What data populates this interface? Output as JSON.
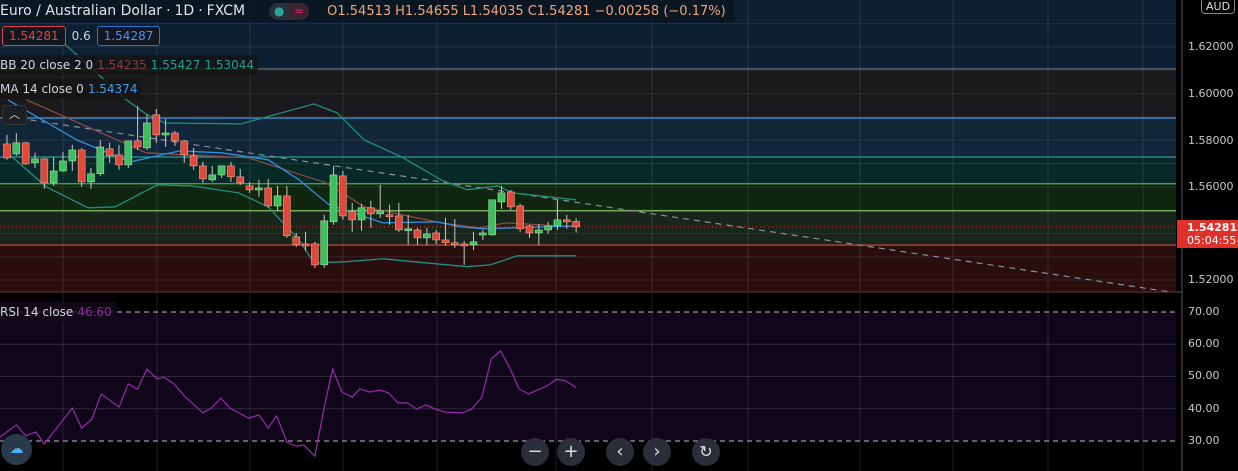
{
  "header": {
    "symbol": "Euro / Australian Dollar",
    "interval": "1D",
    "exchange": "FXCM",
    "separator": "·",
    "toggle_icon": "wave-icon",
    "ohlc": {
      "open": "O1.54513",
      "high": "H1.54655",
      "low": "L1.54035",
      "close": "C1.54281",
      "change": "−0.00258 (−0.17%)"
    }
  },
  "trade": {
    "sell_price": "1.54281",
    "spread": "0.6",
    "buy_price": "1.54287"
  },
  "indicators": {
    "bb": {
      "label": "BB 20 close 2 0",
      "basis": "1.54235",
      "upper": "1.55427",
      "lower": "1.53044"
    },
    "ma": {
      "label": "MA 14 close 0",
      "value": "1.54374"
    },
    "rsi": {
      "label": "RSI 14 close",
      "value": "46.60"
    }
  },
  "price_axis": {
    "currency": "AUD",
    "ticks": [
      "1.62000",
      "1.60000",
      "1.58000",
      "1.56000",
      "1.52000"
    ],
    "current_price": "1.54281",
    "countdown": "05:04:55"
  },
  "rsi_axis": {
    "ticks": [
      "70.00",
      "60.00",
      "50.00",
      "40.00",
      "30.00"
    ]
  },
  "controls": {
    "zoom_out": "−",
    "zoom_in": "+",
    "scroll_left": "‹",
    "scroll_right": "›",
    "reset": "↻"
  },
  "colors": {
    "up": "#3fbf5f",
    "down": "#e0483a",
    "bb_band": "#1f8f80",
    "bb_basis": "#8a4a44",
    "ma": "#2f8fdf",
    "rsi": "#9c27b0",
    "current": "#e0302a"
  },
  "chart_data": {
    "type": "candlestick",
    "price_range": [
      1.515,
      1.63
    ],
    "rsi_range": [
      22,
      78
    ],
    "candles": [
      [
        1.5784,
        1.5823,
        1.5716,
        1.5724
      ],
      [
        1.5741,
        1.5831,
        1.5733,
        1.5789
      ],
      [
        1.5789,
        1.5793,
        1.5694,
        1.5698
      ],
      [
        1.5703,
        1.5746,
        1.5681,
        1.572
      ],
      [
        1.572,
        1.5724,
        1.5591,
        1.5617
      ],
      [
        1.5617,
        1.5728,
        1.5604,
        1.5668
      ],
      [
        1.5668,
        1.575,
        1.5664,
        1.5711
      ],
      [
        1.5711,
        1.578,
        1.5668,
        1.5758
      ],
      [
        1.5758,
        1.5767,
        1.56,
        1.5621
      ],
      [
        1.5621,
        1.5681,
        1.5591,
        1.5656
      ],
      [
        1.5656,
        1.5801,
        1.5647,
        1.5771
      ],
      [
        1.5763,
        1.5789,
        1.5703,
        1.5733
      ],
      [
        1.5737,
        1.578,
        1.5673,
        1.5694
      ],
      [
        1.5694,
        1.5797,
        1.5681,
        1.5797
      ],
      [
        1.5797,
        1.5947,
        1.5758,
        1.5771
      ],
      [
        1.5767,
        1.5909,
        1.5758,
        1.5874
      ],
      [
        1.5909,
        1.5934,
        1.5789,
        1.5823
      ],
      [
        1.5823,
        1.5891,
        1.5771,
        1.5831
      ],
      [
        1.5831,
        1.584,
        1.5776,
        1.5797
      ],
      [
        1.5797,
        1.5801,
        1.5703,
        1.5737
      ],
      [
        1.5733,
        1.5767,
        1.5673,
        1.569
      ],
      [
        1.569,
        1.5707,
        1.5617,
        1.5634
      ],
      [
        1.563,
        1.569,
        1.5621,
        1.5651
      ],
      [
        1.5651,
        1.569,
        1.5638,
        1.569
      ],
      [
        1.569,
        1.5707,
        1.5621,
        1.5643
      ],
      [
        1.5643,
        1.5677,
        1.5608,
        1.5617
      ],
      [
        1.5604,
        1.5621,
        1.5574,
        1.5587
      ],
      [
        1.5587,
        1.563,
        1.5557,
        1.5595
      ],
      [
        1.5595,
        1.5634,
        1.551,
        1.5518
      ],
      [
        1.5518,
        1.5604,
        1.5497,
        1.5561
      ],
      [
        1.5561,
        1.5604,
        1.5381,
        1.539
      ],
      [
        1.5385,
        1.5402,
        1.5342,
        1.5351
      ],
      [
        1.5355,
        1.5407,
        1.5325,
        1.5351
      ],
      [
        1.5355,
        1.5364,
        1.5252,
        1.5265
      ],
      [
        1.5265,
        1.548,
        1.5252,
        1.5454
      ],
      [
        1.545,
        1.569,
        1.5437,
        1.5651
      ],
      [
        1.5647,
        1.5668,
        1.5458,
        1.5475
      ],
      [
        1.5493,
        1.5531,
        1.5407,
        1.5458
      ],
      [
        1.5458,
        1.5527,
        1.5411,
        1.551
      ],
      [
        1.551,
        1.554,
        1.5424,
        1.5484
      ],
      [
        1.5484,
        1.5608,
        1.5467,
        1.5497
      ],
      [
        1.548,
        1.5523,
        1.5437,
        1.5475
      ],
      [
        1.5475,
        1.5531,
        1.5407,
        1.5415
      ],
      [
        1.5415,
        1.548,
        1.5351,
        1.542
      ],
      [
        1.5415,
        1.5424,
        1.5351,
        1.5381
      ],
      [
        1.5381,
        1.5424,
        1.5351,
        1.5398
      ],
      [
        1.5402,
        1.5415,
        1.5355,
        1.5372
      ],
      [
        1.5372,
        1.5467,
        1.5347,
        1.536
      ],
      [
        1.536,
        1.5462,
        1.5338,
        1.5351
      ],
      [
        1.5355,
        1.5368,
        1.5265,
        1.5351
      ],
      [
        1.5351,
        1.5407,
        1.5329,
        1.5364
      ],
      [
        1.5398,
        1.5415,
        1.5372,
        1.5402
      ],
      [
        1.5394,
        1.5544,
        1.539,
        1.5544
      ],
      [
        1.5535,
        1.5604,
        1.5505,
        1.5574
      ],
      [
        1.5578,
        1.5587,
        1.5501,
        1.5514
      ],
      [
        1.5518,
        1.5527,
        1.5407,
        1.542
      ],
      [
        1.5432,
        1.5437,
        1.5381,
        1.5402
      ],
      [
        1.5402,
        1.5441,
        1.5351,
        1.5415
      ],
      [
        1.5415,
        1.545,
        1.5398,
        1.5432
      ],
      [
        1.5432,
        1.5544,
        1.5415,
        1.5458
      ],
      [
        1.5458,
        1.548,
        1.542,
        1.5454
      ],
      [
        1.54513,
        1.54655,
        1.54035,
        1.54281
      ]
    ],
    "bb_upper": [
      [
        6.7,
        1.623
      ],
      [
        13.8,
        1.5973
      ],
      [
        15.9,
        1.5913
      ],
      [
        17.9,
        1.5874
      ],
      [
        26.1,
        1.587
      ],
      [
        33.9,
        1.5956
      ],
      [
        36.4,
        1.5917
      ],
      [
        39.3,
        1.5801
      ],
      [
        43.3,
        1.5728
      ],
      [
        47.5,
        1.563
      ],
      [
        50.3,
        1.5587
      ],
      [
        53.6,
        1.5604
      ],
      [
        55.2,
        1.5574
      ],
      [
        62,
        1.5544
      ]
    ],
    "bb_basis": [
      [
        3.1,
        1.5973
      ],
      [
        15.9,
        1.5746
      ],
      [
        26.9,
        1.5724
      ],
      [
        35.2,
        1.5617
      ],
      [
        39.3,
        1.5514
      ],
      [
        47.5,
        1.5445
      ],
      [
        51.6,
        1.5424
      ],
      [
        54.5,
        1.5445
      ],
      [
        62,
        1.5428
      ]
    ],
    "bb_lower": [
      [
        0.7,
        1.5758
      ],
      [
        5.2,
        1.56
      ],
      [
        9.7,
        1.551
      ],
      [
        12.6,
        1.5514
      ],
      [
        17.1,
        1.5608
      ],
      [
        20.8,
        1.5604
      ],
      [
        25.8,
        1.5574
      ],
      [
        29,
        1.5514
      ],
      [
        32.3,
        1.5372
      ],
      [
        33.9,
        1.5274
      ],
      [
        37.2,
        1.5278
      ],
      [
        41.3,
        1.5291
      ],
      [
        50.3,
        1.5257
      ],
      [
        52.8,
        1.5265
      ],
      [
        55.7,
        1.5304
      ],
      [
        62,
        1.5304
      ]
    ],
    "ma14": [
      [
        1.1,
        1.5973
      ],
      [
        8.5,
        1.5801
      ],
      [
        14.2,
        1.5707
      ],
      [
        19.5,
        1.5754
      ],
      [
        24,
        1.5746
      ],
      [
        29,
        1.5716
      ],
      [
        32.3,
        1.563
      ],
      [
        35.5,
        1.5523
      ],
      [
        41.3,
        1.5445
      ],
      [
        47.1,
        1.545
      ],
      [
        49.6,
        1.5428
      ],
      [
        52,
        1.542
      ],
      [
        62,
        1.5432
      ]
    ],
    "trendline": [
      [
        3.5,
        1.5887
      ],
      [
        125.6,
        1.5149
      ]
    ],
    "fib_levels": [
      {
        "price": 1.6106,
        "line": "#5a6a7a",
        "fill_above": "#0c1f33"
      },
      {
        "price": 1.5895,
        "line": "#4aa0e0",
        "fill_above": "#1a1a1c"
      },
      {
        "price": 1.5728,
        "line": "#2a9a9a",
        "fill_above": "#12263a"
      },
      {
        "price": 1.5613,
        "line": "#4caf50",
        "fill_above": "#072a28"
      },
      {
        "price": 1.5497,
        "line": "#8fcf6f",
        "fill_above": "#11260f"
      },
      {
        "price": 1.535,
        "line": "#e04a3a",
        "fill_above": "#18251a",
        "fill_below": "#2a0e0e"
      }
    ],
    "rsi": [
      [
        0.25,
        31.2
      ],
      [
        2,
        35
      ],
      [
        3,
        31.6
      ],
      [
        4.1,
        32.8
      ],
      [
        5,
        29.1
      ],
      [
        8,
        40.2
      ],
      [
        9,
        34
      ],
      [
        10.1,
        36.8
      ],
      [
        11.1,
        44.6
      ],
      [
        13,
        40.5
      ],
      [
        14,
        47.7
      ],
      [
        15,
        46.1
      ],
      [
        16,
        52.3
      ],
      [
        17.1,
        49.2
      ],
      [
        17.8,
        49.8
      ],
      [
        18.9,
        47.7
      ],
      [
        20,
        44
      ],
      [
        22,
        38.7
      ],
      [
        22.9,
        40.2
      ],
      [
        23.9,
        43.3
      ],
      [
        24.9,
        40.2
      ],
      [
        26.9,
        37.1
      ],
      [
        28,
        38.1
      ],
      [
        29,
        34
      ],
      [
        29.9,
        37.8
      ],
      [
        31,
        29.7
      ],
      [
        32,
        28.4
      ],
      [
        32.8,
        28.8
      ],
      [
        34,
        25.3
      ],
      [
        35,
        40.5
      ],
      [
        35.9,
        52.3
      ],
      [
        36.9,
        45.2
      ],
      [
        38,
        43.6
      ],
      [
        38.8,
        46.1
      ],
      [
        39.9,
        45.2
      ],
      [
        40.9,
        45.8
      ],
      [
        41.9,
        44.9
      ],
      [
        42.9,
        41.8
      ],
      [
        43.9,
        41.8
      ],
      [
        44.9,
        39.9
      ],
      [
        45.9,
        41.2
      ],
      [
        46.9,
        39.9
      ],
      [
        47.9,
        39
      ],
      [
        49.8,
        38.7
      ],
      [
        50.8,
        39.9
      ],
      [
        51.9,
        43.6
      ],
      [
        52.9,
        55.4
      ],
      [
        53.9,
        57.9
      ],
      [
        54.9,
        52.6
      ],
      [
        55.9,
        46.1
      ],
      [
        56.9,
        44.6
      ],
      [
        58.9,
        47.1
      ],
      [
        59.9,
        49.2
      ],
      [
        60.9,
        48.6
      ],
      [
        62,
        46.6
      ]
    ],
    "rsi_bands": [
      70,
      30
    ]
  }
}
